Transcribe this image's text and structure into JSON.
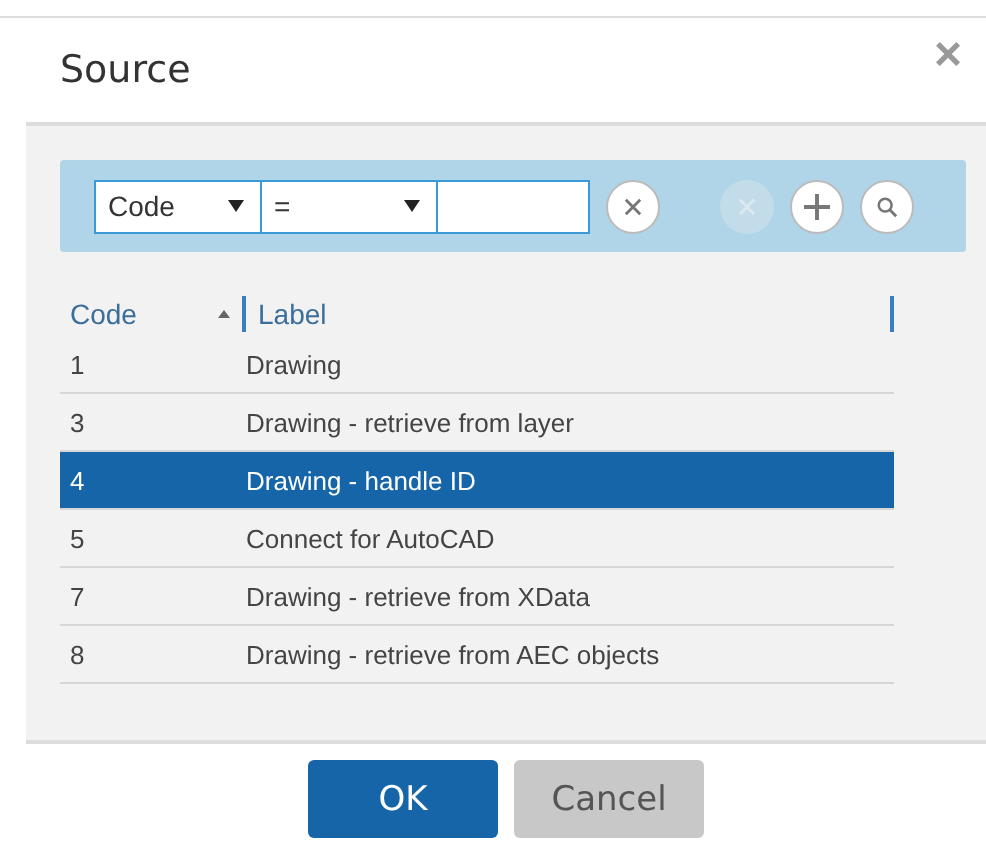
{
  "dialog": {
    "title": "Source",
    "close": "×"
  },
  "filter": {
    "field": "Code",
    "operator": "=",
    "buttons": [
      {
        "kind": "clear",
        "disabled": false
      },
      {
        "kind": "remove",
        "disabled": true
      },
      {
        "kind": "add",
        "disabled": false
      },
      {
        "kind": "search",
        "disabled": false
      }
    ]
  },
  "table": {
    "columns": [
      {
        "label": "Code",
        "sorted": true
      },
      {
        "label": "Label",
        "sorted": false
      }
    ],
    "rows": [
      {
        "code": "1",
        "label": "Drawing",
        "selected": false
      },
      {
        "code": "3",
        "label": "Drawing - retrieve from layer",
        "selected": false
      },
      {
        "code": "4",
        "label": "Drawing - handle ID",
        "selected": true
      },
      {
        "code": "5",
        "label": "Connect for AutoCAD",
        "selected": false
      },
      {
        "code": "7",
        "label": "Drawing - retrieve from XData",
        "selected": false
      },
      {
        "code": "8",
        "label": "Drawing - retrieve from AEC objects",
        "selected": false
      }
    ]
  },
  "buttons": [
    {
      "label": "OK",
      "kind": "primary"
    },
    {
      "label": "Cancel",
      "kind": "secondary"
    }
  ]
}
